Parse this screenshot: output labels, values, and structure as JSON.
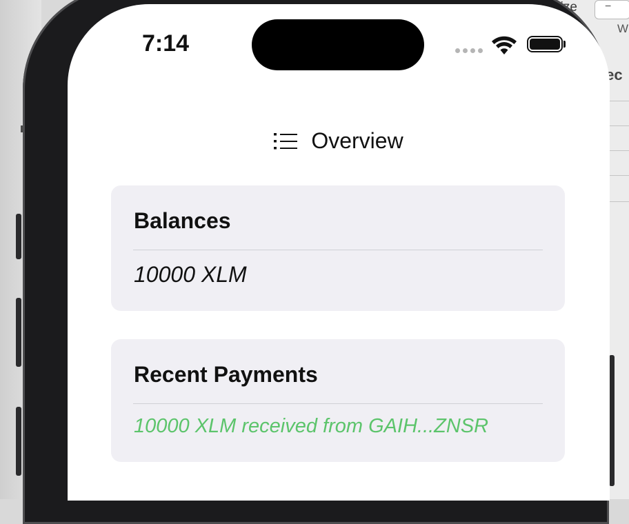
{
  "background": {
    "size_label": "Size",
    "stepper_label": "−",
    "w_label": "W",
    "object_label": "jec"
  },
  "status_bar": {
    "time": "7:14"
  },
  "nav": {
    "title": "Overview",
    "icon": "list-icon"
  },
  "balances": {
    "title": "Balances",
    "value": "10000 XLM"
  },
  "recent_payments": {
    "title": "Recent Payments",
    "items": [
      {
        "text": "10000 XLM received from GAIH...ZNSR",
        "color": "#5cc46b"
      }
    ]
  },
  "colors": {
    "card_bg": "#f0eff4",
    "accent_green": "#5cc46b"
  }
}
